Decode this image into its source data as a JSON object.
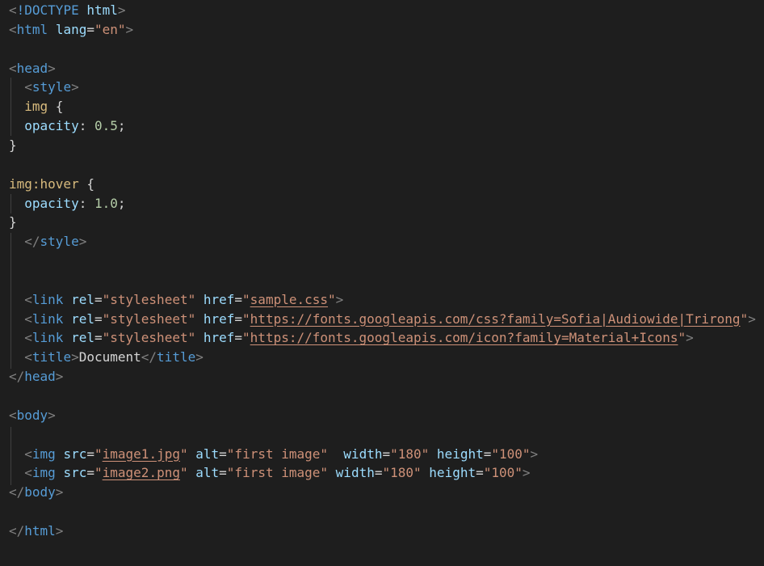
{
  "colors": {
    "background": "#1e1e1e",
    "tag_bracket": "#808080",
    "tag_name": "#569cd6",
    "attribute_name": "#9cdcfe",
    "attribute_value": "#ce9178",
    "selector": "#d7ba7d",
    "number": "#b5cea8",
    "plain_text": "#d4d4d4"
  },
  "code": {
    "lines": [
      [
        {
          "t": "<",
          "c": "tg"
        },
        {
          "t": "!DOCTYPE",
          "c": "tn"
        },
        {
          "t": " ",
          "c": "pl"
        },
        {
          "t": "html",
          "c": "an"
        },
        {
          "t": ">",
          "c": "tg"
        }
      ],
      [
        {
          "t": "<",
          "c": "tg"
        },
        {
          "t": "html",
          "c": "tn"
        },
        {
          "t": " ",
          "c": "pl"
        },
        {
          "t": "lang",
          "c": "an"
        },
        {
          "t": "=",
          "c": "pl"
        },
        {
          "t": "\"en\"",
          "c": "av"
        },
        {
          "t": ">",
          "c": "tg"
        }
      ],
      [],
      [
        {
          "t": "<",
          "c": "tg"
        },
        {
          "t": "head",
          "c": "tn"
        },
        {
          "t": ">",
          "c": "tg"
        }
      ],
      [
        {
          "t": "  ",
          "c": "pl"
        },
        {
          "t": "<",
          "c": "tg"
        },
        {
          "t": "style",
          "c": "tn"
        },
        {
          "t": ">",
          "c": "tg"
        }
      ],
      [
        {
          "t": "  ",
          "c": "pl"
        },
        {
          "t": "img",
          "c": "sel"
        },
        {
          "t": " {",
          "c": "pl"
        }
      ],
      [
        {
          "t": "  ",
          "c": "pl"
        },
        {
          "t": "opacity",
          "c": "an"
        },
        {
          "t": ": ",
          "c": "pl"
        },
        {
          "t": "0.5",
          "c": "num"
        },
        {
          "t": ";",
          "c": "pl"
        }
      ],
      [
        {
          "t": "}",
          "c": "pl"
        }
      ],
      [],
      [
        {
          "t": "img:hover",
          "c": "sel"
        },
        {
          "t": " {",
          "c": "pl"
        }
      ],
      [
        {
          "t": "  ",
          "c": "pl"
        },
        {
          "t": "opacity",
          "c": "an"
        },
        {
          "t": ": ",
          "c": "pl"
        },
        {
          "t": "1.0",
          "c": "num"
        },
        {
          "t": ";",
          "c": "pl"
        }
      ],
      [
        {
          "t": "}",
          "c": "pl"
        }
      ],
      [
        {
          "t": "  ",
          "c": "pl"
        },
        {
          "t": "</",
          "c": "tg"
        },
        {
          "t": "style",
          "c": "tn"
        },
        {
          "t": ">",
          "c": "tg"
        }
      ],
      [],
      [],
      [
        {
          "t": "  ",
          "c": "pl"
        },
        {
          "t": "<",
          "c": "tg"
        },
        {
          "t": "link",
          "c": "tn"
        },
        {
          "t": " ",
          "c": "pl"
        },
        {
          "t": "rel",
          "c": "an"
        },
        {
          "t": "=",
          "c": "pl"
        },
        {
          "t": "\"stylesheet\"",
          "c": "av"
        },
        {
          "t": " ",
          "c": "pl"
        },
        {
          "t": "href",
          "c": "an"
        },
        {
          "t": "=",
          "c": "pl"
        },
        {
          "t": "\"",
          "c": "av"
        },
        {
          "t": "sample.css",
          "c": "av u"
        },
        {
          "t": "\"",
          "c": "av"
        },
        {
          "t": ">",
          "c": "tg"
        }
      ],
      [
        {
          "t": "  ",
          "c": "pl"
        },
        {
          "t": "<",
          "c": "tg"
        },
        {
          "t": "link",
          "c": "tn"
        },
        {
          "t": " ",
          "c": "pl"
        },
        {
          "t": "rel",
          "c": "an"
        },
        {
          "t": "=",
          "c": "pl"
        },
        {
          "t": "\"stylesheet\"",
          "c": "av"
        },
        {
          "t": " ",
          "c": "pl"
        },
        {
          "t": "href",
          "c": "an"
        },
        {
          "t": "=",
          "c": "pl"
        },
        {
          "t": "\"",
          "c": "av"
        },
        {
          "t": "https://fonts.googleapis.com/css?family=Sofia|Audiowide|Trirong",
          "c": "av u"
        },
        {
          "t": "\"",
          "c": "av"
        },
        {
          "t": ">",
          "c": "tg"
        }
      ],
      [
        {
          "t": "  ",
          "c": "pl"
        },
        {
          "t": "<",
          "c": "tg"
        },
        {
          "t": "link",
          "c": "tn"
        },
        {
          "t": " ",
          "c": "pl"
        },
        {
          "t": "rel",
          "c": "an"
        },
        {
          "t": "=",
          "c": "pl"
        },
        {
          "t": "\"stylesheet\"",
          "c": "av"
        },
        {
          "t": " ",
          "c": "pl"
        },
        {
          "t": "href",
          "c": "an"
        },
        {
          "t": "=",
          "c": "pl"
        },
        {
          "t": "\"",
          "c": "av"
        },
        {
          "t": "https://fonts.googleapis.com/icon?family=Material+Icons",
          "c": "av u"
        },
        {
          "t": "\"",
          "c": "av"
        },
        {
          "t": ">",
          "c": "tg"
        }
      ],
      [
        {
          "t": "  ",
          "c": "pl"
        },
        {
          "t": "<",
          "c": "tg"
        },
        {
          "t": "title",
          "c": "tn"
        },
        {
          "t": ">",
          "c": "tg"
        },
        {
          "t": "Document",
          "c": "pl"
        },
        {
          "t": "</",
          "c": "tg"
        },
        {
          "t": "title",
          "c": "tn"
        },
        {
          "t": ">",
          "c": "tg"
        }
      ],
      [
        {
          "t": "</",
          "c": "tg"
        },
        {
          "t": "head",
          "c": "tn"
        },
        {
          "t": ">",
          "c": "tg"
        }
      ],
      [],
      [
        {
          "t": "<",
          "c": "tg"
        },
        {
          "t": "body",
          "c": "tn"
        },
        {
          "t": ">",
          "c": "tg"
        }
      ],
      [],
      [
        {
          "t": "  ",
          "c": "pl"
        },
        {
          "t": "<",
          "c": "tg"
        },
        {
          "t": "img",
          "c": "tn"
        },
        {
          "t": " ",
          "c": "pl"
        },
        {
          "t": "src",
          "c": "an"
        },
        {
          "t": "=",
          "c": "pl"
        },
        {
          "t": "\"",
          "c": "av"
        },
        {
          "t": "image1.jpg",
          "c": "av u"
        },
        {
          "t": "\"",
          "c": "av"
        },
        {
          "t": " ",
          "c": "pl"
        },
        {
          "t": "alt",
          "c": "an"
        },
        {
          "t": "=",
          "c": "pl"
        },
        {
          "t": "\"first image\"",
          "c": "av"
        },
        {
          "t": "  ",
          "c": "pl"
        },
        {
          "t": "width",
          "c": "an"
        },
        {
          "t": "=",
          "c": "pl"
        },
        {
          "t": "\"180\"",
          "c": "av"
        },
        {
          "t": " ",
          "c": "pl"
        },
        {
          "t": "height",
          "c": "an"
        },
        {
          "t": "=",
          "c": "pl"
        },
        {
          "t": "\"100\"",
          "c": "av"
        },
        {
          "t": ">",
          "c": "tg"
        }
      ],
      [
        {
          "t": "  ",
          "c": "pl"
        },
        {
          "t": "<",
          "c": "tg"
        },
        {
          "t": "img",
          "c": "tn"
        },
        {
          "t": " ",
          "c": "pl"
        },
        {
          "t": "src",
          "c": "an"
        },
        {
          "t": "=",
          "c": "pl"
        },
        {
          "t": "\"",
          "c": "av"
        },
        {
          "t": "image2.png",
          "c": "av u"
        },
        {
          "t": "\"",
          "c": "av"
        },
        {
          "t": " ",
          "c": "pl"
        },
        {
          "t": "alt",
          "c": "an"
        },
        {
          "t": "=",
          "c": "pl"
        },
        {
          "t": "\"first image\"",
          "c": "av"
        },
        {
          "t": " ",
          "c": "pl"
        },
        {
          "t": "width",
          "c": "an"
        },
        {
          "t": "=",
          "c": "pl"
        },
        {
          "t": "\"180\"",
          "c": "av"
        },
        {
          "t": " ",
          "c": "pl"
        },
        {
          "t": "height",
          "c": "an"
        },
        {
          "t": "=",
          "c": "pl"
        },
        {
          "t": "\"100\"",
          "c": "av"
        },
        {
          "t": ">",
          "c": "tg"
        }
      ],
      [
        {
          "t": "</",
          "c": "tg"
        },
        {
          "t": "body",
          "c": "tn"
        },
        {
          "t": ">",
          "c": "tg"
        }
      ],
      [],
      [
        {
          "t": "</",
          "c": "tg"
        },
        {
          "t": "html",
          "c": "tn"
        },
        {
          "t": ">",
          "c": "tg"
        }
      ]
    ]
  }
}
